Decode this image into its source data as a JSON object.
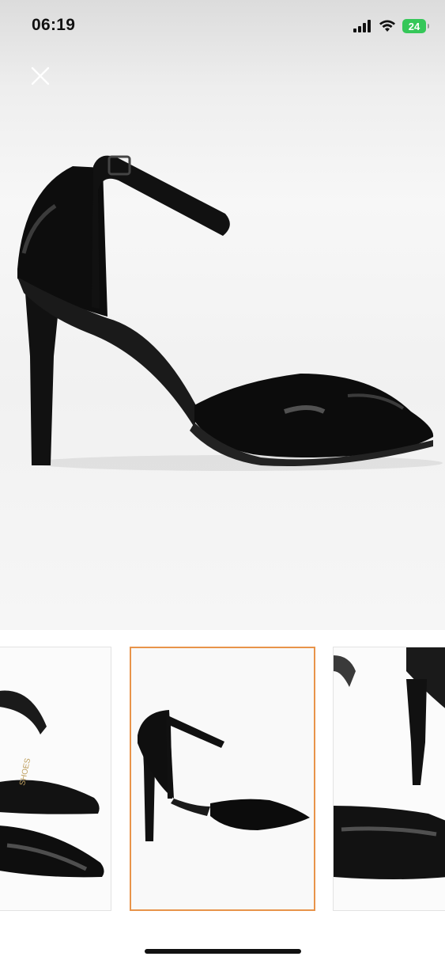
{
  "status_bar": {
    "time": "06:19",
    "battery": "24",
    "battery_color": "#35c759",
    "icons": [
      "signal-icon",
      "wifi-icon",
      "battery-icon"
    ]
  },
  "viewer": {
    "close_icon": "close-icon",
    "thumbnails": [
      {
        "name": "thumbnail-toe-closeup",
        "selected": false
      },
      {
        "name": "thumbnail-side-view",
        "selected": true
      },
      {
        "name": "thumbnail-heel-closeup",
        "selected": false
      }
    ],
    "thumbnail_brand_text": "SHOES",
    "accent_color": "#e8944a"
  }
}
